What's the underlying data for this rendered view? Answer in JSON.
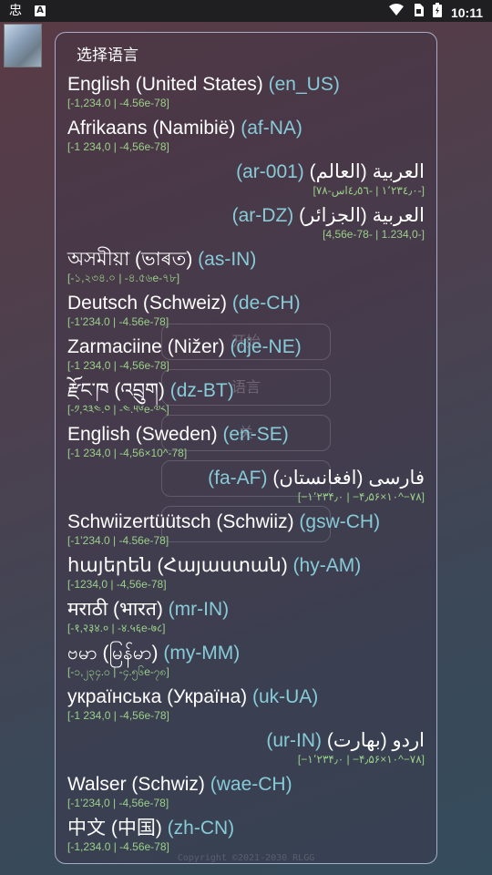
{
  "status_bar": {
    "time": "10:11",
    "icons": [
      "app-notification-icon",
      "accessibility-a-icon",
      "wifi-icon",
      "sim-icon",
      "battery-icon"
    ]
  },
  "background_buttons": [
    "开始",
    "语言",
    "关",
    "",
    ""
  ],
  "dialog": {
    "title": "选择语言",
    "items": [
      {
        "name": "English (United States)",
        "code": "(en_US)",
        "sample": "[-1,234.0 | -4.56e-78]",
        "rtl": false
      },
      {
        "name": "Afrikaans (Namibië)",
        "code": "(af-NA)",
        "sample": "[-1 234,0 | -4,56e-78]",
        "rtl": false
      },
      {
        "name": "العربية (العالم)",
        "code": "(ar-001)",
        "sample": "[؜-١٬٢٣٤٫٠ | ؜-٤٫٥٦اس؜-٧٨]",
        "rtl": true
      },
      {
        "name": "العربية (الجزائر)",
        "code": "(ar-DZ)",
        "sample": "[-1.234,0 | -4,56e-78]",
        "rtl": true
      },
      {
        "name": "অসমীয়া (ভাৰত)",
        "code": "(as-IN)",
        "sample": "[-১,২৩৪.০ | -৪.৫৬e-৭৮]",
        "rtl": false
      },
      {
        "name": "Deutsch (Schweiz)",
        "code": "(de-CH)",
        "sample": "[-1’234.0 | -4.56e-78]",
        "rtl": false
      },
      {
        "name": "Zarmaciine (Nižer)",
        "code": "(dje-NE)",
        "sample": "[-1 234,0 | -4,56e-78]",
        "rtl": false
      },
      {
        "name": "རྫོང་ཁ (འབྲུག)",
        "code": "(dz-BT)",
        "sample": "[-༡,༢༣༤.༠ | -༤.༥༦e-༧༨]",
        "rtl": false
      },
      {
        "name": "English (Sweden)",
        "code": "(en-SE)",
        "sample": "[-1 234,0 | -4,56×10^-78]",
        "rtl": false
      },
      {
        "name": "فارسی (افغانستان)",
        "code": "(fa-AF)",
        "sample": "[‎−۱٬۲۳۴٫۰ | ‎−۴٫۵۶×۱۰^‎−۷۸]",
        "rtl": true
      },
      {
        "name": "Schwiizertüütsch (Schwiiz)",
        "code": "(gsw-CH)",
        "sample": "[-1’234.0 | -4.56e-78]",
        "rtl": false
      },
      {
        "name": "հայերեն (Հայաստան)",
        "code": "(hy-AM)",
        "sample": "[-1234,0 | -4,56e-78]",
        "rtl": false
      },
      {
        "name": "मराठी (भारत)",
        "code": "(mr-IN)",
        "sample": "[-१,२३४.० | -४.५६e-७८]",
        "rtl": false
      },
      {
        "name": "ဗမာ (မြန်မာ)",
        "code": "(my-MM)",
        "sample": "[-၁,၂၃၄.၀ | -၄.၅၆e-၇၈]",
        "rtl": false
      },
      {
        "name": "українська (Україна)",
        "code": "(uk-UA)",
        "sample": "[-1 234,0 | -4,56e-78]",
        "rtl": false
      },
      {
        "name": "اردو (بھارت)",
        "code": "(ur-IN)",
        "sample": "[‎−۱٬۲۳۴٫۰ | ‎−۴٫۵۶×۱۰^‎−۷۸]",
        "rtl": true
      },
      {
        "name": "Walser (Schwiz)",
        "code": "(wae-CH)",
        "sample": "[-1’234,0 | -4,56e-78]",
        "rtl": false
      },
      {
        "name": "中文 (中国)",
        "code": "(zh-CN)",
        "sample": "[-1,234.0 | -4.56e-78]",
        "rtl": false
      }
    ]
  },
  "footer": "Copyright ©2021-2030 RLGG",
  "colors": {
    "name": "#ffffff",
    "code": "#87cbd8",
    "sample": "#9ad089",
    "dialog_border": "#c8d2f0"
  }
}
